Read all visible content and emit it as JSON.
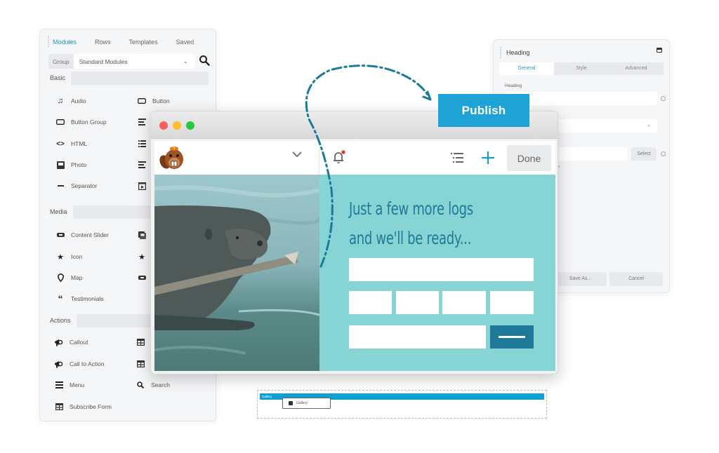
{
  "modules_panel": {
    "tabs": [
      {
        "label": "Modules",
        "active": true
      },
      {
        "label": "Rows",
        "active": false
      },
      {
        "label": "Templates",
        "active": false
      },
      {
        "label": "Saved",
        "active": false
      }
    ],
    "group_label": "Group",
    "group_value": "Standard Modules",
    "sections": {
      "basic": "Basic",
      "media": "Media",
      "actions": "Actions"
    },
    "basic_items": [
      {
        "label": "Audio",
        "icon": "music-note-icon"
      },
      {
        "label": "Button",
        "icon": "button-icon"
      },
      {
        "label": "Button Group",
        "icon": "button-icon"
      },
      {
        "label": "",
        "icon": "text-editor-icon"
      },
      {
        "label": "HTML",
        "icon": "code-icon"
      },
      {
        "label": "",
        "icon": "list-icon"
      },
      {
        "label": "Photo",
        "icon": "photo-icon"
      },
      {
        "label": "",
        "icon": "text-editor-icon"
      },
      {
        "label": "Separator",
        "icon": "separator-icon"
      },
      {
        "label": "",
        "icon": "video-icon"
      }
    ],
    "media_items": [
      {
        "label": "Content Slider",
        "icon": "slider-icon"
      },
      {
        "label": "",
        "icon": "gallery-icon"
      },
      {
        "label": "Icon",
        "icon": "star-icon"
      },
      {
        "label": "",
        "icon": "star-icon"
      },
      {
        "label": "Map",
        "icon": "map-pin-icon"
      },
      {
        "label": "",
        "icon": "slider-icon"
      },
      {
        "label": "Testimonials",
        "icon": "quote-icon"
      }
    ],
    "action_items": [
      {
        "label": "Callout",
        "icon": "megaphone-icon"
      },
      {
        "label": "",
        "icon": "table-icon"
      },
      {
        "label": "Call to Action",
        "icon": "megaphone-icon"
      },
      {
        "label": "",
        "icon": "table-icon"
      },
      {
        "label": "Menu",
        "icon": "menu-icon"
      },
      {
        "label": "Search",
        "icon": "search-icon"
      },
      {
        "label": "Subscribe Form",
        "icon": "table-icon"
      }
    ]
  },
  "settings_panel": {
    "title": "Heading",
    "tabs": [
      {
        "label": "General",
        "active": true
      },
      {
        "label": "Style",
        "active": false
      },
      {
        "label": "Advanced",
        "active": false
      }
    ],
    "heading_label": "Heading",
    "select_button": "Select",
    "nofollow_hint": "llow",
    "save_as_button": "Save As...",
    "cancel_button": "Cancel"
  },
  "publish_button": "Publish",
  "browser": {
    "traffic_lights": {
      "close": "#fc5f57",
      "minimize": "#fdbc2e",
      "maximize": "#28c840"
    },
    "done_button": "Done",
    "headline_line1": "Just a few more logs",
    "headline_line2": "and we'll be ready...",
    "colors": {
      "teal_bg": "#86d5d4",
      "headline": "#1f7a99",
      "submit": "#1e7a98",
      "accent_plus": "#1e9bc8",
      "notification_dot": "#e0362c"
    }
  },
  "row_preview": {
    "row_label": "Gallery",
    "module_label": "Gallery"
  }
}
